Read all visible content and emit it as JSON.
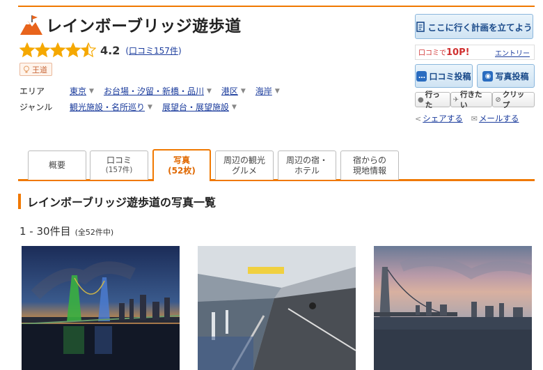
{
  "spot": {
    "title": "レインボーブリッジ遊歩道",
    "score": "4.2",
    "review_link_open": "(",
    "review_link_text": "口コミ157件",
    "review_link_close": ")",
    "rating_stars": 4.5,
    "badge": "王道"
  },
  "meta": {
    "area_label": "エリア",
    "area_items": [
      "東京",
      "お台場・汐留・新橋・品川",
      "港区",
      "海岸"
    ],
    "genre_label": "ジャンル",
    "genre_items": [
      "観光施設・名所巡り",
      "展望台・展望施設"
    ]
  },
  "panel": {
    "plan_label": "ここに行く計画を立てよう",
    "points_prefix": "口コミで",
    "points_value": "10P!",
    "entry_label": "エントリー",
    "review_post": "口コミ投稿",
    "photo_post": "写真投稿",
    "went": "行った",
    "want": "行きたい",
    "clip": "クリップ",
    "share": "シェアする",
    "mail": "メールする"
  },
  "tabs": [
    {
      "label": "概要",
      "sub": ""
    },
    {
      "label": "口コミ",
      "sub": "(157件)"
    },
    {
      "label": "写真",
      "sub": "(52枚)"
    },
    {
      "label": "周辺の観光",
      "sub": "グルメ"
    },
    {
      "label": "周辺の宿・",
      "sub": "ホテル"
    },
    {
      "label": "宿からの",
      "sub": "現地情報"
    }
  ],
  "section_title": "レインボーブリッジ遊歩道の写真一覧",
  "count": {
    "range": "1 - 30件目",
    "total": "(全52件中)"
  },
  "colors": {
    "accent": "#f07800",
    "link": "#1a3b9c",
    "star": "#f5a800"
  }
}
